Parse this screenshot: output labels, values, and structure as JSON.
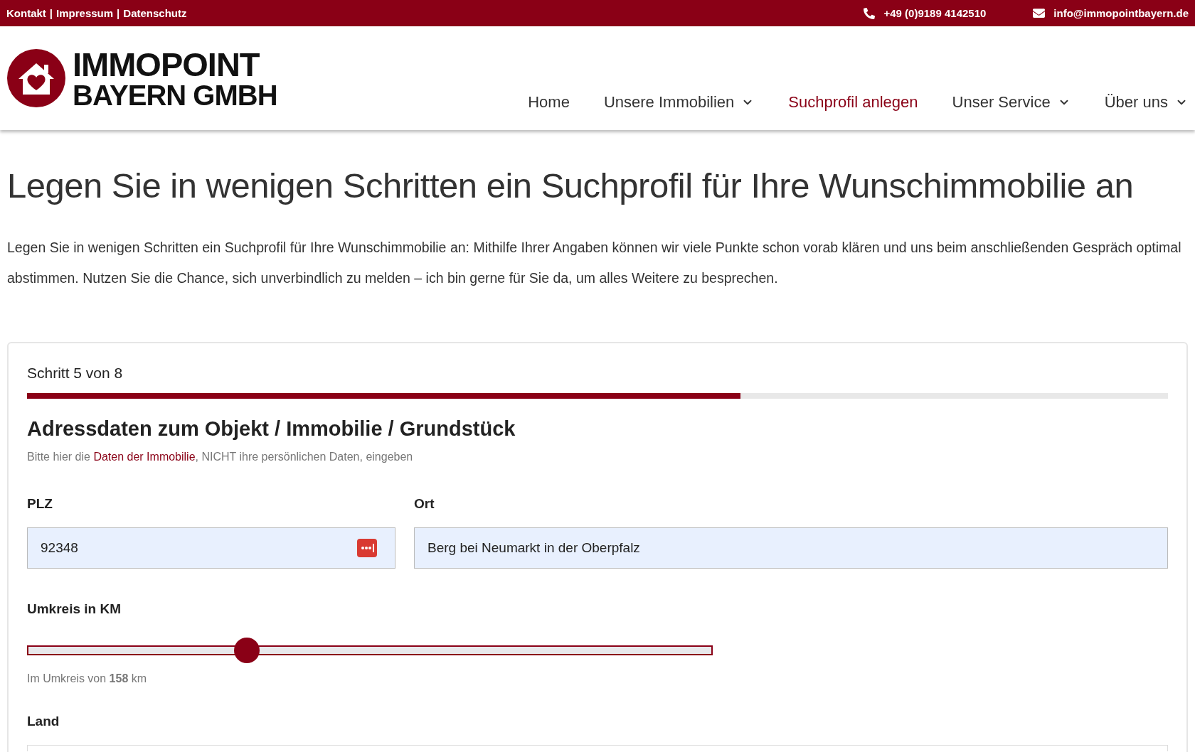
{
  "top_bar": {
    "links": [
      "Kontakt",
      "Impressum",
      "Datenschutz"
    ],
    "separator": "|",
    "phone": "+49 (0)9189 4142510",
    "email": "info@immopointbayern.de"
  },
  "logo": {
    "line_1": "IMMOPOINT",
    "line_2": "BAYERN GMBH"
  },
  "nav": [
    {
      "label": "Home",
      "selected": false,
      "has_dropdown": false
    },
    {
      "label": "Unsere Immobilien",
      "selected": false,
      "has_dropdown": true
    },
    {
      "label": "Suchprofil anlegen",
      "selected": true,
      "has_dropdown": false
    },
    {
      "label": "Unser Service",
      "selected": false,
      "has_dropdown": true
    },
    {
      "label": "Über uns",
      "selected": false,
      "has_dropdown": true
    }
  ],
  "page_title": "Legen Sie in wenigen Schritten ein Suchprofil für Ihre Wunschimmobilie an",
  "intro": "Legen Sie in wenigen Schritten ein Suchprofil für Ihre Wunschimmobilie an: Mithilfe Ihrer Angaben können wir viele Punkte schon vorab klären und uns beim anschließenden Gespräch optimal abstimmen. Nutzen Sie die Chance, sich unverbindlich zu melden – ich bin gerne für Sie da, um alles Weitere zu besprechen.",
  "form": {
    "step": "Schritt 5 von 8",
    "progress": {
      "level": 0.625
    },
    "section_title": "Adressdaten zum Objekt / Immobilie / Grundstück",
    "hint": {
      "before": "Bitte hier die ",
      "link": "Daten der Immobilie",
      "after": ", NICHT ihre persönlichen Daten, eingeben"
    },
    "fields": [
      {
        "label": "PLZ",
        "value": "92348",
        "autofill_icon": true
      },
      {
        "label": "Ort",
        "value": "Berg bei Neumarkt in der Oberpfalz",
        "autofill_icon": false
      }
    ],
    "radius": {
      "label": "Umkreis in KM",
      "level": 0.32,
      "reading": "Im Umkreis von **158** km"
    },
    "country": {
      "label": "Land"
    }
  }
}
